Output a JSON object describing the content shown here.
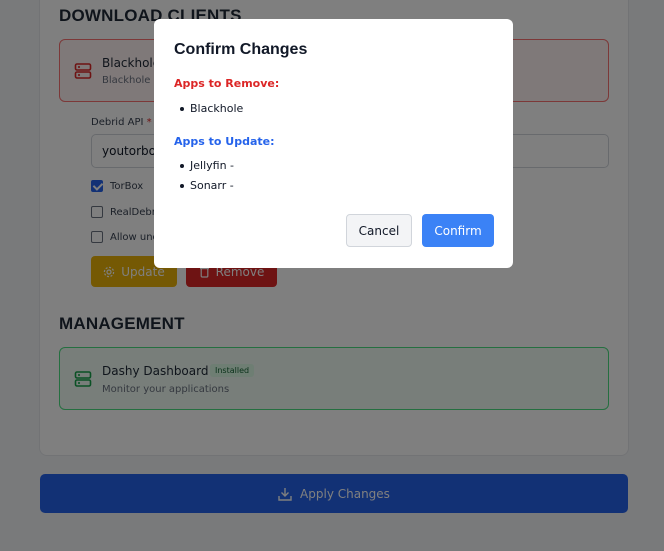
{
  "sections": {
    "download_clients_title": "DOWNLOAD CLIENTS",
    "management_title": "MANAGEMENT"
  },
  "blackhole": {
    "name": "Blackhole",
    "description": "Blackhole d"
  },
  "debrid": {
    "label": "Debrid API",
    "required_mark": "*",
    "value": "youtorbox"
  },
  "options": [
    {
      "label": "TorBox",
      "checked": true
    },
    {
      "label": "RealDebrid",
      "checked": false
    },
    {
      "label": "Allow unc",
      "checked": false
    }
  ],
  "actions": {
    "update_label": "Update",
    "remove_label": "Remove"
  },
  "dashy": {
    "name": "Dashy Dashboard",
    "badge": "Installed",
    "description": "Monitor your applications"
  },
  "apply": {
    "label": "Apply Changes"
  },
  "modal": {
    "title": "Confirm Changes",
    "remove_heading": "Apps to Remove:",
    "remove_items": [
      "Blackhole"
    ],
    "update_heading": "Apps to Update:",
    "update_items": [
      "Jellyfin -",
      "Sonarr -"
    ],
    "cancel_label": "Cancel",
    "confirm_label": "Confirm"
  },
  "colors": {
    "danger": "#dc2626",
    "accent": "#2563eb",
    "warning": "#eab308",
    "success": "#22c55e"
  },
  "icons": {
    "server": "server-icon",
    "gear": "gear-icon",
    "trash": "trash-icon",
    "download": "download-icon"
  }
}
